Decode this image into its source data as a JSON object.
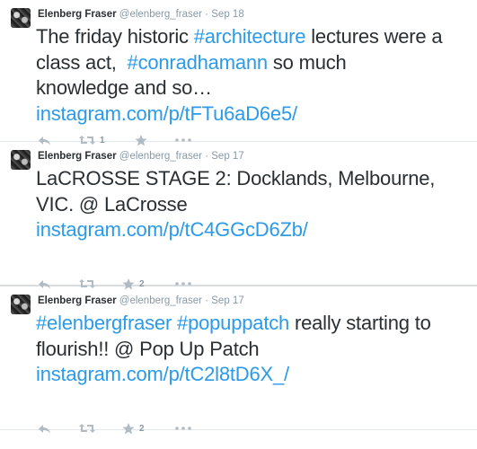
{
  "tweets": [
    {
      "name": "Elenberg Fraser",
      "handle": "@elenberg_fraser",
      "sep": "·",
      "date": "Sep 18",
      "line1_pre": "The friday historic ",
      "line1_tag": "#architecture",
      "line1_post": " lectures were a",
      "line2_pre": "class act,  ",
      "line2_tag": "#conradhamann",
      "line2_post": " so much",
      "line3": "knowledge and so…",
      "link": "instagram.com/p/tFTu6aD6e5/",
      "retweets": "1",
      "favorites": ""
    },
    {
      "name": "Elenberg Fraser",
      "handle": "@elenberg_fraser",
      "sep": "·",
      "date": "Sep 17",
      "line1": "LaCROSSE STAGE 2: Docklands, Melbourne,",
      "line2": "VIC. @ LaCrosse",
      "link": "instagram.com/p/tC4GGcD6Zb/",
      "retweets": "",
      "favorites": "2"
    },
    {
      "name": "Elenberg Fraser",
      "handle": "@elenberg_fraser",
      "sep": "·",
      "date": "Sep 17",
      "line1_tag1": "#elenbergfraser",
      "line1_space": " ",
      "line1_tag2": "#popuppatch",
      "line1_post": " really starting to",
      "line2": "flourish!! @ Pop Up Patch",
      "link": "instagram.com/p/tC2l8tD6X_/",
      "retweets": "",
      "favorites": "2"
    }
  ],
  "icons": {
    "reply": "reply-icon",
    "retweet": "retweet-icon",
    "favorite": "star-icon",
    "more": "more-icon"
  },
  "colors": {
    "link": "#2b9ae8",
    "text": "#292f33",
    "muted": "#8899a6",
    "icon": "#b1bbc3",
    "divider": "#e1e8ed"
  }
}
